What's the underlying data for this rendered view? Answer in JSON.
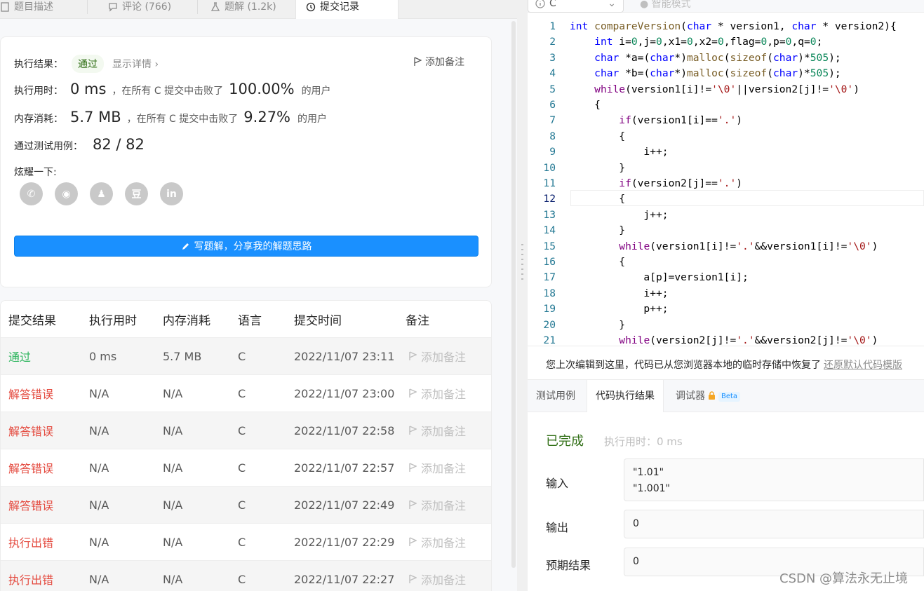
{
  "left_tabs": [
    {
      "label": "题目描述",
      "icon": "document-icon"
    },
    {
      "label": "评论 (766)",
      "icon": "comment-icon"
    },
    {
      "label": "题解 (1.2k)",
      "icon": "flask-icon"
    },
    {
      "label": "提交记录",
      "icon": "clock-icon"
    }
  ],
  "result": {
    "label": "执行结果：",
    "status": "通过",
    "detail": "显示详情 ›",
    "note": "添加备注",
    "time_label": "执行用时：",
    "time_value": "0 ms",
    "time_text": "，在所有 C 提交中击败了",
    "time_pct": "100.00%",
    "time_suffix": "的用户",
    "mem_label": "内存消耗：",
    "mem_value": "5.7 MB",
    "mem_text": "，在所有 C 提交中击败了",
    "mem_pct": "9.27%",
    "mem_suffix": "的用户",
    "cases_label": "通过测试用例：",
    "cases_value": "82 / 82",
    "share_label": "炫耀一下:",
    "share_icons": [
      "wechat-icon",
      "weibo-icon",
      "qq-icon",
      "douban-icon",
      "linkedin-icon"
    ],
    "share_glyphs": [
      "✆",
      "◉",
      "♟",
      "豆",
      "in"
    ],
    "write_button": "写题解，分享我的解题思路"
  },
  "table": {
    "headers": [
      "提交结果",
      "执行用时",
      "内存消耗",
      "语言",
      "提交时间",
      "备注"
    ],
    "rows": [
      {
        "status": "通过",
        "ok": true,
        "time": "0 ms",
        "mem": "5.7 MB",
        "lang": "C",
        "date": "2022/11/07 23:11",
        "note": "添加备注"
      },
      {
        "status": "解答错误",
        "ok": false,
        "time": "N/A",
        "mem": "N/A",
        "lang": "C",
        "date": "2022/11/07 23:00",
        "note": "添加备注"
      },
      {
        "status": "解答错误",
        "ok": false,
        "time": "N/A",
        "mem": "N/A",
        "lang": "C",
        "date": "2022/11/07 22:58",
        "note": "添加备注"
      },
      {
        "status": "解答错误",
        "ok": false,
        "time": "N/A",
        "mem": "N/A",
        "lang": "C",
        "date": "2022/11/07 22:57",
        "note": "添加备注"
      },
      {
        "status": "解答错误",
        "ok": false,
        "time": "N/A",
        "mem": "N/A",
        "lang": "C",
        "date": "2022/11/07 22:49",
        "note": "添加备注"
      },
      {
        "status": "执行出错",
        "ok": false,
        "time": "N/A",
        "mem": "N/A",
        "lang": "C",
        "date": "2022/11/07 22:29",
        "note": "添加备注"
      },
      {
        "status": "执行出错",
        "ok": false,
        "time": "N/A",
        "mem": "N/A",
        "lang": "C",
        "date": "2022/11/07 22:27",
        "note": "添加备注"
      }
    ]
  },
  "editor": {
    "language": "C",
    "smart_mode": "智能模式",
    "current_line": 12,
    "lines": [
      "int compareVersion(char * version1, char * version2){",
      "    int i=0,j=0,x1=0,x2=0,flag=0,p=0,q=0;",
      "    char *a=(char*)malloc(sizeof(char)*505);",
      "    char *b=(char*)malloc(sizeof(char)*505);",
      "    while(version1[i]!='\\0'||version2[j]!='\\0')",
      "    {",
      "        if(version1[i]=='.')",
      "        {",
      "            i++;",
      "        }",
      "        if(version2[j]=='.')",
      "        {",
      "            j++;",
      "        }",
      "        while(version1[i]!='.'&&version1[i]!='\\0')",
      "        {",
      "            a[p]=version1[i];",
      "            i++;",
      "            p++;",
      "        }",
      "        while(version2[j]!='.'&&version2[j]!='\\0')"
    ]
  },
  "restore": {
    "message": "您上次编辑到这里，代码已从您浏览器本地的临时存储中恢复了",
    "link": "还原默认代码模版"
  },
  "result_tabs": [
    {
      "label": "测试用例"
    },
    {
      "label": "代码执行结果"
    },
    {
      "label": "调试器",
      "badge": "Beta"
    }
  ],
  "run": {
    "status": "已完成",
    "runtime": "执行用时：0 ms",
    "input_label": "输入",
    "input_lines": [
      "\"1.01\"",
      "\"1.001\""
    ],
    "output_label": "输出",
    "output_value": "0",
    "expected_label": "预期结果",
    "expected_value": "0"
  },
  "watermark": "CSDN @算法永无止境",
  "colors": {
    "accent": "#1a90ff",
    "pass": "#2db55d",
    "error": "#e44a3f"
  }
}
